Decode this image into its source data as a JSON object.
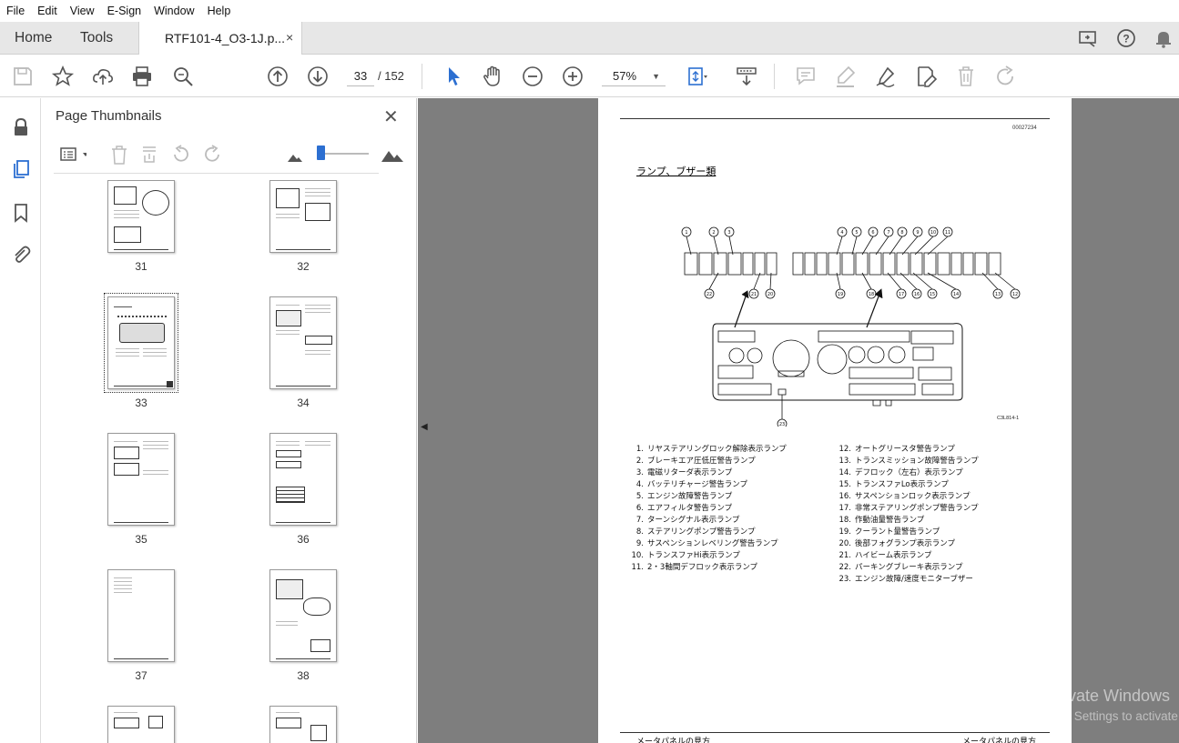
{
  "menu": [
    "File",
    "Edit",
    "View",
    "E-Sign",
    "Window",
    "Help"
  ],
  "tabs": {
    "home": "Home",
    "tools": "Tools",
    "document": "RTF101-4_O3-1J.p...",
    "close": "×"
  },
  "toolbar": {
    "page_current": "33",
    "page_total": "/ 152",
    "zoom": "57%"
  },
  "panel": {
    "title": "Page Thumbnails",
    "close": "✕",
    "pages": [
      "31",
      "32",
      "33",
      "34",
      "35",
      "36",
      "37",
      "38"
    ],
    "selected_page": "33"
  },
  "document": {
    "code": "00027234",
    "title": "ランプ、ブザー類",
    "figure_code": "C3L814-1",
    "legend_left": [
      {
        "n": "1.",
        "t": "リヤステアリングロック解除表示ランプ"
      },
      {
        "n": "2.",
        "t": "ブレーキエア圧低圧警告ランプ"
      },
      {
        "n": "3.",
        "t": "電磁リターダ表示ランプ"
      },
      {
        "n": "4.",
        "t": "バッテリチャージ警告ランプ"
      },
      {
        "n": "5.",
        "t": "エンジン故障警告ランプ"
      },
      {
        "n": "6.",
        "t": "エアフィルタ警告ランプ"
      },
      {
        "n": "7.",
        "t": "ターンシグナル表示ランプ"
      },
      {
        "n": "8.",
        "t": "ステアリングポンプ警告ランプ"
      },
      {
        "n": "9.",
        "t": "サスペンションレベリング警告ランプ"
      },
      {
        "n": "10.",
        "t": "トランスファHi表示ランプ"
      },
      {
        "n": "11.",
        "t": "2・3軸間デフロック表示ランプ"
      }
    ],
    "legend_right": [
      {
        "n": "12.",
        "t": "オートグリースタ警告ランプ"
      },
      {
        "n": "13.",
        "t": "トランスミッション故障警告ランプ"
      },
      {
        "n": "14.",
        "t": "デフロック（左右）表示ランプ"
      },
      {
        "n": "15.",
        "t": "トランスファLo表示ランプ"
      },
      {
        "n": "16.",
        "t": "サスペンションロック表示ランプ"
      },
      {
        "n": "17.",
        "t": "非常ステアリングポンプ警告ランプ"
      },
      {
        "n": "18.",
        "t": "作動油量警告ランプ"
      },
      {
        "n": "19.",
        "t": "クーラント量警告ランプ"
      },
      {
        "n": "20.",
        "t": "後部フォグランプ表示ランプ"
      },
      {
        "n": "21.",
        "t": "ハイビーム表示ランプ"
      },
      {
        "n": "22.",
        "t": "パーキングブレーキ表示ランプ"
      },
      {
        "n": "23.",
        "t": "エンジン故障/速度モニターブザー"
      }
    ],
    "footer_left": "メータパネルの見方",
    "footer_right": "メータパネルの見方"
  },
  "watermark": {
    "line1": "Activate Windows",
    "line2": "Go to Settings to activate"
  }
}
